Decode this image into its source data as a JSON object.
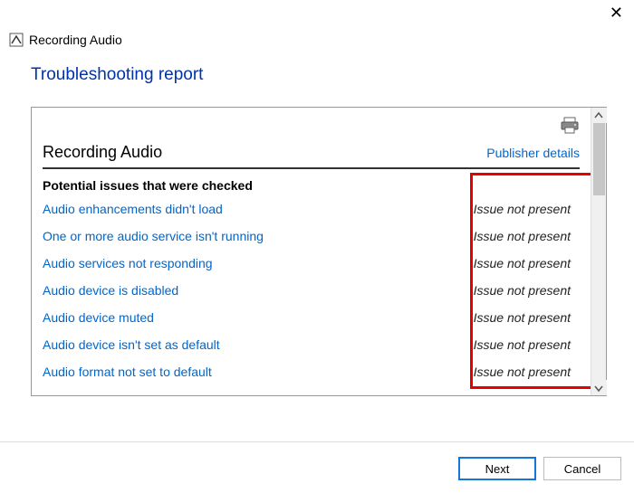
{
  "window": {
    "title": "Recording Audio"
  },
  "page": {
    "heading": "Troubleshooting report"
  },
  "report": {
    "section_title": "Recording Audio",
    "publisher_link": "Publisher details",
    "issues_heading": "Potential issues that were checked",
    "issues": [
      {
        "name": "Audio enhancements didn't load",
        "status": "Issue not present"
      },
      {
        "name": "One or more audio service isn't running",
        "status": "Issue not present"
      },
      {
        "name": "Audio services not responding",
        "status": "Issue not present"
      },
      {
        "name": "Audio device is disabled",
        "status": "Issue not present"
      },
      {
        "name": "Audio device muted",
        "status": "Issue not present"
      },
      {
        "name": "Audio device isn't set as default",
        "status": "Issue not present"
      },
      {
        "name": "Audio format not set to default",
        "status": "Issue not present"
      }
    ]
  },
  "buttons": {
    "next": "Next",
    "cancel": "Cancel"
  }
}
